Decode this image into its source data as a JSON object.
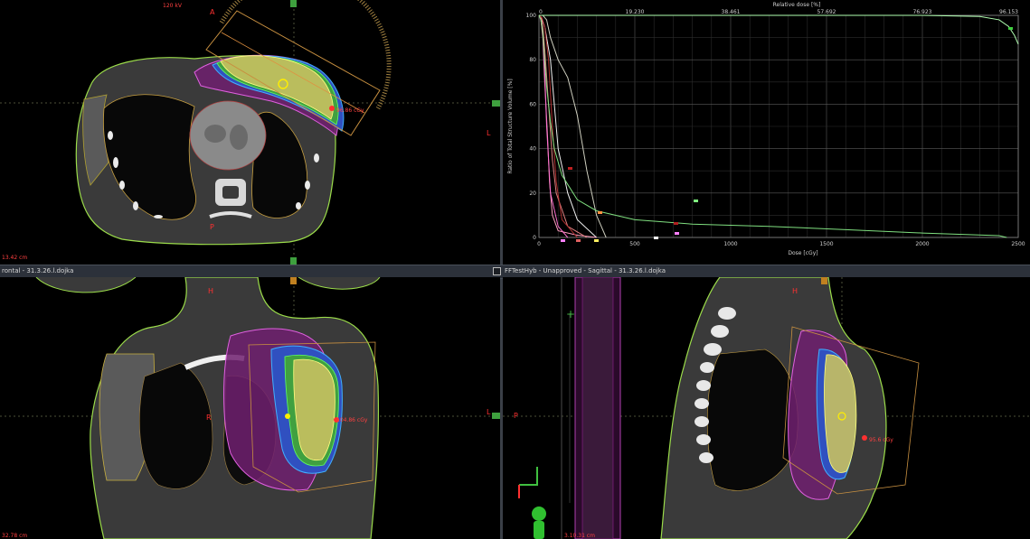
{
  "axial": {
    "kv_label": "120 kV",
    "orient_top": "A",
    "orient_bottom": "P",
    "orient_right": "L",
    "dose_point": "96.86 cGy",
    "scale_label": "13.42 cm"
  },
  "dvh": {
    "top_axis_title": "Relative dose [%]",
    "y_axis_title": "Ratio of Total Structure Volume [%]",
    "x_axis_title": "Dose [cGy]"
  },
  "bar": {
    "left_title": "rontal - 31.3.26.l.dojka",
    "right_title": "FFTestHyb - Unapproved - Sagittal - 31.3.26.l.dojka"
  },
  "frontal": {
    "orient_top": "H",
    "orient_left": "R",
    "orient_right": "L",
    "dose_point": "104.86 cGy",
    "scale_label": "32.78 cm"
  },
  "sagittal": {
    "orient_top": "H",
    "orient_left": "P",
    "dose_point": "95.6 cGy",
    "scale_label": "3.10.31 cm"
  },
  "chart_data": {
    "type": "line",
    "title": "",
    "xlabel": "Dose [cGy]",
    "ylabel": "Ratio of Total Structure Volume [%]",
    "x2label": "Relative dose [%]",
    "xlim": [
      0,
      2500
    ],
    "ylim": [
      0,
      100
    ],
    "xticks": [
      0,
      500,
      1000,
      1500,
      2000,
      2500
    ],
    "yticks": [
      0,
      20,
      40,
      60,
      80,
      100
    ],
    "x2ticks": [
      "0",
      "19.230",
      "38.461",
      "57.692",
      "76.923",
      "96.153"
    ],
    "grid": true,
    "series": [
      {
        "color": "#f0f0f0",
        "x": [
          0,
          10,
          30,
          60,
          80,
          100,
          150,
          200,
          300
        ],
        "y": [
          100,
          99,
          95,
          80,
          60,
          40,
          20,
          8,
          0
        ]
      },
      {
        "color": "#ff9fc0",
        "x": [
          0,
          10,
          20,
          30,
          45,
          55,
          70,
          100,
          200,
          300
        ],
        "y": [
          100,
          98,
          90,
          70,
          45,
          25,
          10,
          3,
          1,
          0
        ]
      },
      {
        "color": "#e08080",
        "x": [
          0,
          10,
          20,
          30,
          50,
          70,
          90,
          150,
          250
        ],
        "y": [
          100,
          99,
          95,
          85,
          60,
          35,
          20,
          5,
          0
        ]
      },
      {
        "color": "#b03030",
        "x": [
          0,
          15,
          30,
          50,
          70,
          90,
          120,
          200
        ],
        "y": [
          100,
          99,
          95,
          80,
          50,
          25,
          8,
          0
        ]
      },
      {
        "color": "#ff6fd0",
        "x": [
          0,
          10,
          20,
          30,
          40,
          60,
          100,
          150
        ],
        "y": [
          100,
          98,
          92,
          75,
          50,
          20,
          5,
          0
        ]
      },
      {
        "color": "#d0d0c0",
        "x": [
          0,
          20,
          40,
          60,
          100,
          150,
          200,
          250,
          300,
          350
        ],
        "y": [
          100,
          100,
          98,
          90,
          80,
          72,
          55,
          30,
          10,
          0
        ]
      },
      {
        "color": "#80e080",
        "x": [
          0,
          10,
          20,
          30,
          40,
          60,
          80,
          120,
          200,
          300,
          500,
          800,
          1200,
          1600,
          2000,
          2400,
          2440
        ],
        "y": [
          100,
          98,
          92,
          80,
          68,
          52,
          40,
          28,
          17,
          12,
          8,
          6,
          5,
          3.5,
          2,
          0.8,
          0
        ]
      },
      {
        "color": "#b0ffb0",
        "x": [
          0,
          500,
          1000,
          1500,
          2000,
          2300,
          2400,
          2450,
          2480,
          2500
        ],
        "y": [
          100,
          100,
          100,
          100,
          100,
          99.5,
          98,
          95,
          91,
          87
        ]
      }
    ]
  }
}
